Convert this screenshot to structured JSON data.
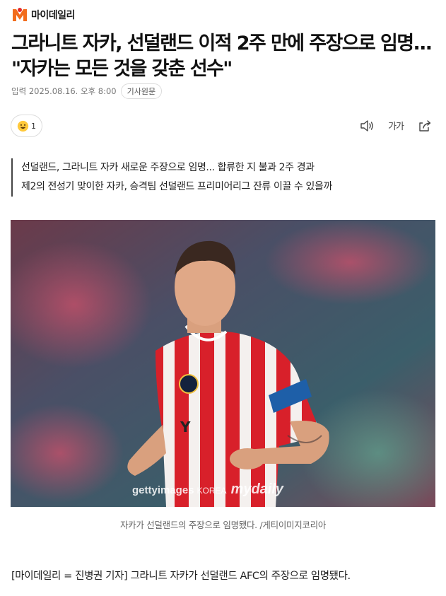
{
  "brand": {
    "name": "마이데일리"
  },
  "article": {
    "title": "그라니트 자카, 선덜랜드 이적 2주 만에 주장으로 임명... \"자카는 모든 것을 갖춘 선수\"",
    "published": "입력 2025.08.16. 오후 8:00",
    "original_label": "기사원문",
    "reaction_count": "1",
    "font_size_label": "가가",
    "summary": [
      "선덜랜드, 그라니트 자카 새로운 주장으로 임명... 합류한 지 불과 2주 경과",
      "제2의 전성기 맞이한 자카, 승격팀 선덜랜드 프리미어리그 잔류 이끌 수 있을까"
    ],
    "photo": {
      "watermark_getty": "gettyimages",
      "watermark_korea": "KOREA",
      "watermark_mydaily": "mydaily",
      "caption": "자카가 선덜랜드의 주장으로 임명됐다. /게티이미지코리아"
    },
    "body_first": "[마이데일리 = 진병권 기자] 그라니트 자카가 선덜랜드 AFC의 주장으로 임명됐다."
  },
  "icons": {
    "reaction": "smiley-emoji-icon",
    "audio": "speaker-icon",
    "font_size": "font-size-icon",
    "share": "share-icon"
  },
  "colors": {
    "brand_orange": "#f26c1d",
    "brand_red": "#e4292b",
    "shirt_red": "#d8202a",
    "captain_band": "#1e5fa8"
  }
}
